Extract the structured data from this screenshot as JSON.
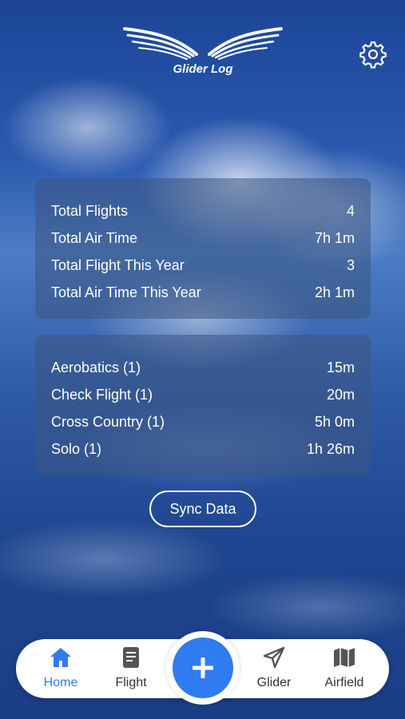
{
  "app": {
    "logo_text": "Glider Log"
  },
  "header": {
    "settings_icon": "gear-icon"
  },
  "stats": [
    {
      "label": "Total Flights",
      "value": "4"
    },
    {
      "label": "Total Air Time",
      "value": "7h 1m"
    },
    {
      "label": "Total Flight This Year",
      "value": "3"
    },
    {
      "label": "Total Air Time This Year",
      "value": "2h 1m"
    }
  ],
  "flight_types": [
    {
      "label": "Aerobatics (1)",
      "value": "15m"
    },
    {
      "label": "Check Flight (1)",
      "value": "20m"
    },
    {
      "label": "Cross Country (1)",
      "value": "5h 0m"
    },
    {
      "label": "Solo (1)",
      "value": "1h 26m"
    }
  ],
  "sync_button": {
    "label": "Sync Data"
  },
  "tabbar": {
    "home": {
      "label": "Home",
      "icon": "home-icon"
    },
    "flight": {
      "label": "Flight",
      "icon": "document-icon"
    },
    "add": {
      "icon": "plus-icon"
    },
    "glider": {
      "label": "Glider",
      "icon": "navigation-arrow-icon"
    },
    "airfield": {
      "label": "Airfield",
      "icon": "map-icon"
    }
  },
  "colors": {
    "accent": "#2f7bf0",
    "text_on_bg": "#ffffff",
    "inactive_tab": "#555555"
  }
}
